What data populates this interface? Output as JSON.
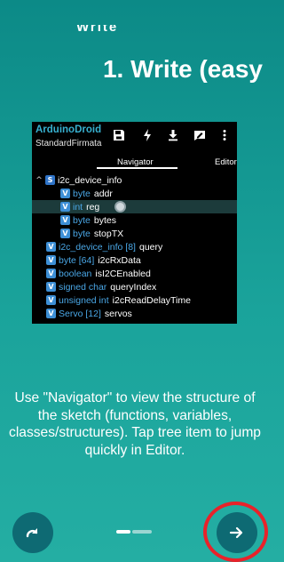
{
  "top_fragment": "Write",
  "title": "1. Write (easy",
  "app": {
    "name": "ArduinoDroid",
    "subtitle": "StandardFirmata",
    "toolbar_icons": [
      "save-icon",
      "flash-icon",
      "download-icon",
      "edit-icon",
      "more-vert-icon"
    ],
    "tabs": [
      {
        "label": "Navigator",
        "active": true
      },
      {
        "label": "Editor",
        "active": false
      }
    ]
  },
  "tree": [
    {
      "badge": "S",
      "type": "",
      "name": "i2c_device_info",
      "expandable": true,
      "indent": 0,
      "highlighted": false
    },
    {
      "badge": "V",
      "type": "byte",
      "name": "addr",
      "expandable": false,
      "indent": 1,
      "highlighted": false
    },
    {
      "badge": "V",
      "type": "int",
      "name": "reg",
      "expandable": false,
      "indent": 1,
      "highlighted": true
    },
    {
      "badge": "V",
      "type": "byte",
      "name": "bytes",
      "expandable": false,
      "indent": 1,
      "highlighted": false
    },
    {
      "badge": "V",
      "type": "byte",
      "name": "stopTX",
      "expandable": false,
      "indent": 1,
      "highlighted": false
    },
    {
      "badge": "V",
      "type": "i2c_device_info [8]",
      "name": "query",
      "expandable": false,
      "indent": 0,
      "highlighted": false
    },
    {
      "badge": "V",
      "type": "byte [64]",
      "name": "i2cRxData",
      "expandable": false,
      "indent": 0,
      "highlighted": false
    },
    {
      "badge": "V",
      "type": "boolean",
      "name": "isI2CEnabled",
      "expandable": false,
      "indent": 0,
      "highlighted": false
    },
    {
      "badge": "V",
      "type": "signed char",
      "name": "queryIndex",
      "expandable": false,
      "indent": 0,
      "highlighted": false
    },
    {
      "badge": "V",
      "type": "unsigned int",
      "name": "i2cReadDelayTime",
      "expandable": false,
      "indent": 0,
      "highlighted": false
    },
    {
      "badge": "V",
      "type": "Servo [12]",
      "name": "servos",
      "expandable": false,
      "indent": 0,
      "highlighted": false
    }
  ],
  "description": "Use \"Navigator\" to view the structure of the sketch (functions, variables, classes/structures). Tap tree item to jump quickly in Editor.",
  "nav": {
    "back_icon": "redo-icon",
    "next_icon": "arrow-right-icon",
    "page_index": 1,
    "page_count": 2
  },
  "colors": {
    "background": "#0c8a87",
    "accent_text": "#37b0cf",
    "type_text": "#4aa7e6",
    "badge": "#3d8fd6",
    "highlight_ring": "#e8222a"
  }
}
